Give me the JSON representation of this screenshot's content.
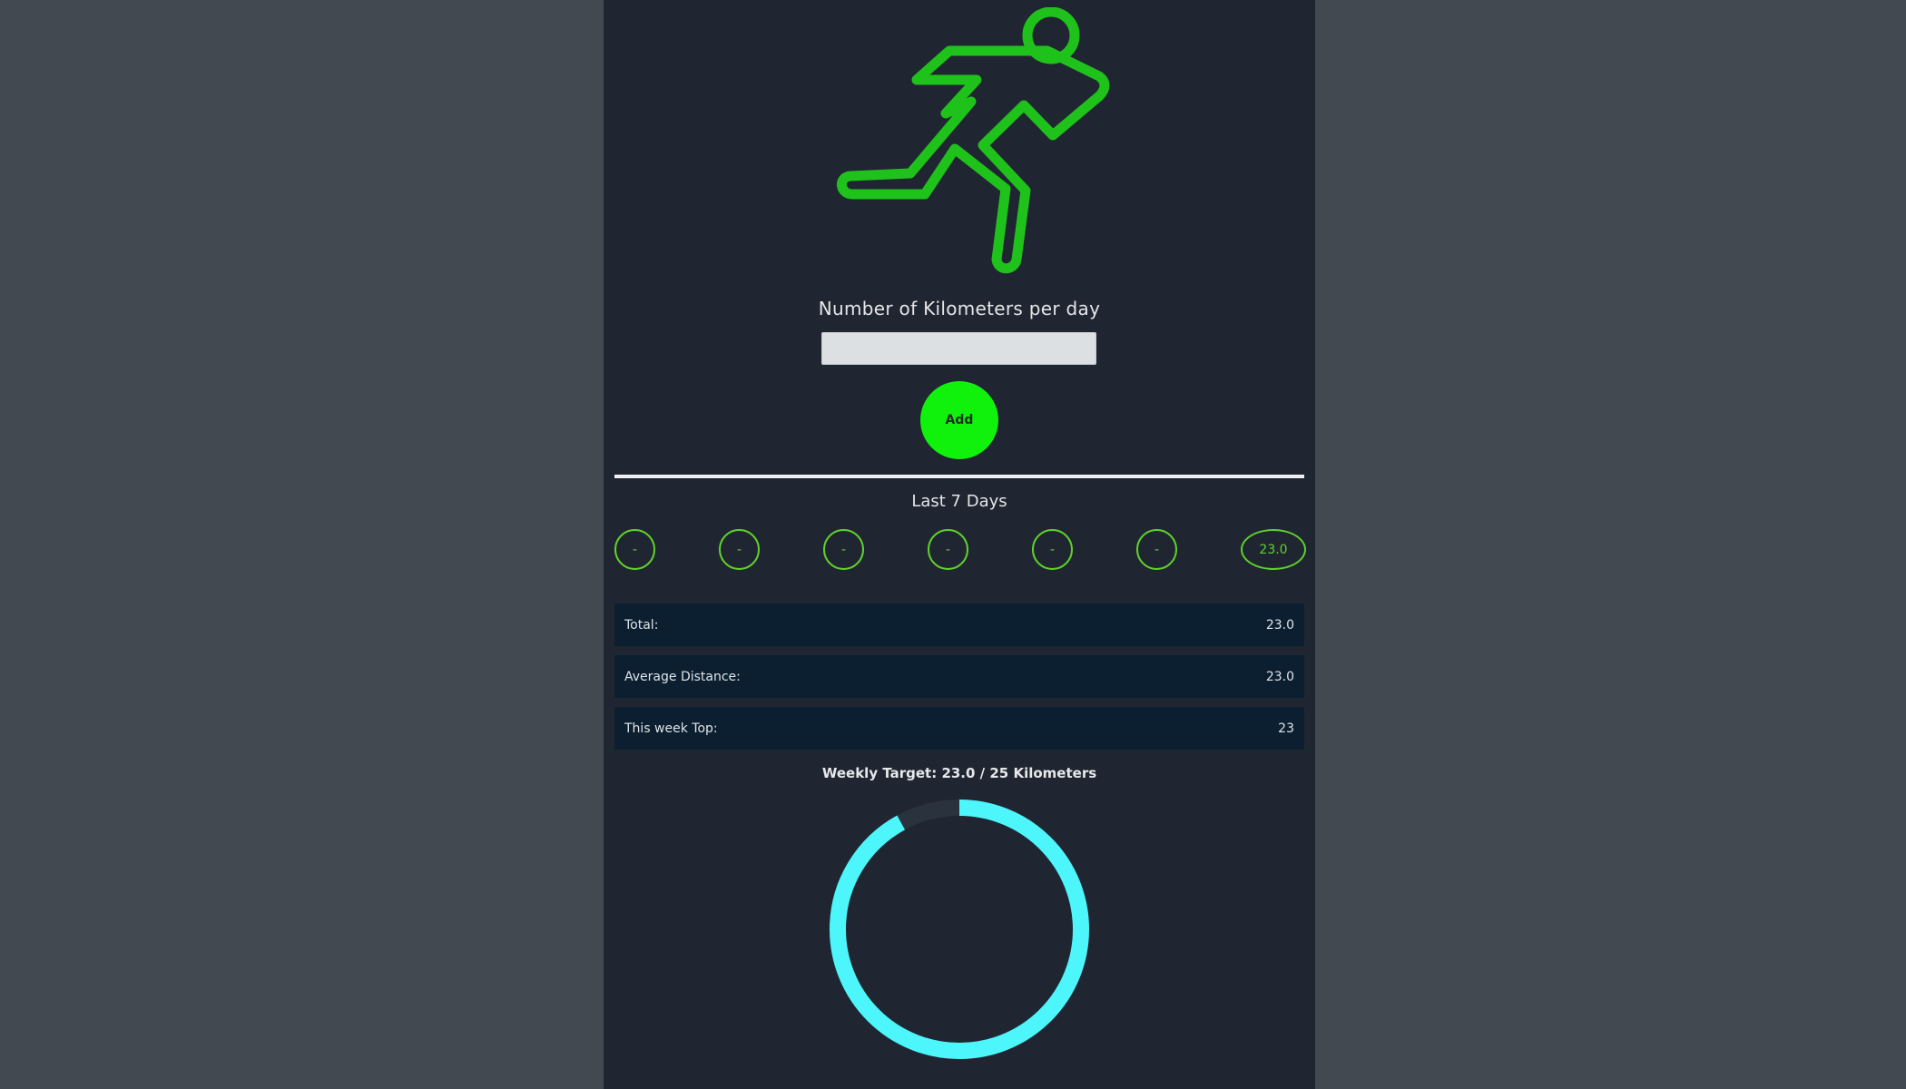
{
  "input_section": {
    "label": "Number of Kilometers per day",
    "value": "",
    "placeholder": "",
    "add_label": "Add"
  },
  "last_days": {
    "title": "Last 7 Days",
    "days": [
      "-",
      "-",
      "-",
      "-",
      "-",
      "-",
      "23.0"
    ]
  },
  "stats": {
    "total_label": "Total:",
    "total_value": "23.0",
    "average_label": "Average Distance:",
    "average_value": "23.0",
    "top_label": "This week Top:",
    "top_value": "23"
  },
  "target": {
    "title": "Weekly Target: 23.0 / 25 Kilometers",
    "progress_fraction": 0.92
  },
  "colors": {
    "accent_green": "#10f20c",
    "icon_green": "#1fc21a",
    "day_green": "#5fd12a",
    "ring_cyan": "#4df6fb",
    "ring_track": "#2a323d",
    "panel_bg": "#1f2631",
    "page_bg": "#434951",
    "stat_bg": "#0b1f31"
  },
  "icons": {
    "hero": "running-person-icon"
  }
}
